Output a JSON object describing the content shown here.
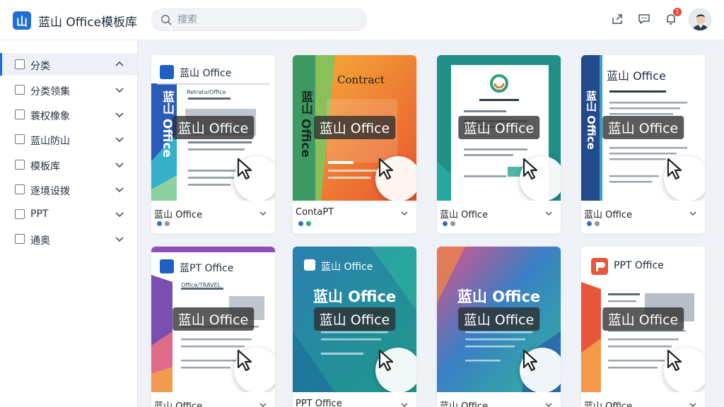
{
  "app": {
    "logo_char": "山",
    "title": "蓝山 Office模板库"
  },
  "search": {
    "placeholder": "搜索"
  },
  "topbar": {
    "notification_count": "1"
  },
  "sidebar": {
    "items": [
      {
        "label": "分类",
        "active": true,
        "expanded": true
      },
      {
        "label": "分类领集",
        "active": false,
        "expanded": false
      },
      {
        "label": "蓑权橡象",
        "active": false,
        "expanded": false
      },
      {
        "label": "蓝山防山",
        "active": false,
        "expanded": false
      },
      {
        "label": "模板库",
        "active": false,
        "expanded": false
      },
      {
        "label": "逐境设拨",
        "active": false,
        "expanded": false
      },
      {
        "label": "PPT",
        "active": false,
        "expanded": false
      },
      {
        "label": "通奥",
        "active": false,
        "expanded": false
      }
    ]
  },
  "cards": [
    {
      "name": "蓝山 Office",
      "overlay": "蓝山 Office",
      "thumb_title": "蓝山 Office",
      "thumb_sub": "Retrato/Office",
      "vertical": "蓝山 Office",
      "dots": [
        "#2f6fd0",
        "#9a8fa8"
      ]
    },
    {
      "name": "ContaPT",
      "overlay": "蓝山 Office",
      "thumb_title": "Contract",
      "vertical": "蓝山 Office",
      "dots": [
        "#2f6fd0",
        "#2fa38a"
      ]
    },
    {
      "name": "蓝山 Office",
      "overlay": "蓝山 Office",
      "dots": [
        "#2f6fd0",
        "#9a8fa8"
      ]
    },
    {
      "name": "蓝山 Office",
      "overlay": "蓝山 Office",
      "thumb_title": "蓝山 Office",
      "vertical": "蓝山 Office",
      "dots": [
        "#2f6fd0",
        "#9a8fa8"
      ]
    },
    {
      "name": "蓝山 Office",
      "overlay": "蓝山 Office",
      "thumb_title": "蓝PT Office",
      "thumb_sub": "Office/TRAVEL",
      "dots": [
        "#2f6fd0",
        "#9a8fa8"
      ]
    },
    {
      "name": "PPT Office",
      "overlay": "蓝山 Office",
      "thumb_title": "蓝山 Office",
      "hero": "蓝山 Office",
      "dots": [
        "#2f6fd0",
        "#9a8fa8"
      ]
    },
    {
      "name": "蓝山 Office",
      "overlay": "蓝山 Office",
      "thumb_title": "蓝山 Office",
      "hero": "蓝山 Office",
      "dots": [
        "#2f6fd0",
        "#9a8fa8"
      ]
    },
    {
      "name": "蓝山 Office",
      "overlay": "蓝山 Office",
      "thumb_title": "PPT Office",
      "dots": [
        "#2f6fd0",
        "#9a8fa8"
      ]
    }
  ],
  "colors": {
    "accent": "#1f6fd6",
    "badge": "#e8473c"
  }
}
